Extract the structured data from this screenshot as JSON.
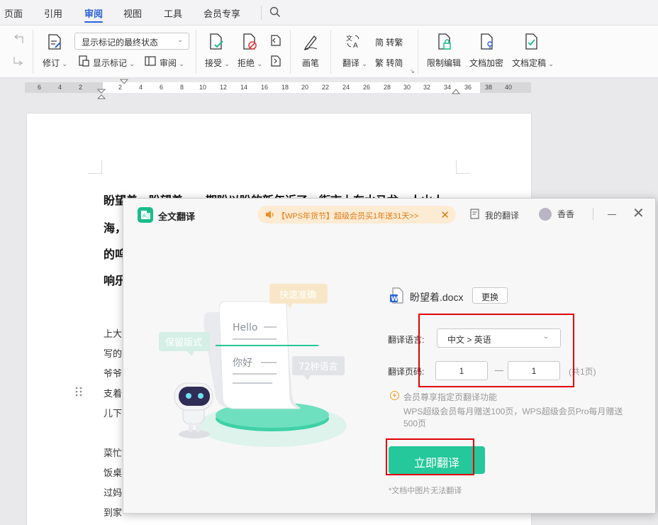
{
  "menubar": {
    "tabs": [
      {
        "label": "页面"
      },
      {
        "label": "引用"
      },
      {
        "label": "审阅"
      },
      {
        "label": "视图"
      },
      {
        "label": "工具"
      },
      {
        "label": "会员专享"
      }
    ],
    "active_tab": "审阅"
  },
  "ribbon": {
    "revise_label": "修订",
    "markup_state": "显示标记的最终状态",
    "show_markup_label": "显示标记",
    "review_label": "审阅",
    "accept_label": "接受",
    "reject_label": "拒绝",
    "pen_label": "画笔",
    "translate_label": "翻译",
    "to_traditional_label": "简 转繁",
    "to_simplified_label": "繁 转简",
    "restrict_edit_label": "限制编辑",
    "encrypt_label": "文档加密",
    "finalize_label": "文档定稿"
  },
  "ruler": {
    "left_numbers": [
      "6",
      "4",
      "2"
    ],
    "right_numbers": [
      "2",
      "4",
      "6",
      "8",
      "10",
      "12",
      "14",
      "16",
      "18",
      "20",
      "22",
      "24",
      "26",
      "28",
      "30",
      "32",
      "34",
      "36",
      "38",
      "40"
    ]
  },
  "document": {
    "heading_lines": [
      "盼望着，盼望着……期盼以盼的新年近了，街市上车水马龙，人山人",
      "海，",
      "的呜",
      "响乐"
    ],
    "body_lines": [
      "上大",
      "写的",
      "爷爷",
      "支着",
      "儿下",
      "菜忙",
      "饭桌",
      "过妈",
      "到家"
    ]
  },
  "dialog": {
    "title": "全文翻译",
    "promo_text": "【WPS年货节】超级会员买1年送31天>>",
    "my_translations": "我的翻译",
    "username": "香香",
    "illustration": {
      "tag_fast": "快速准确",
      "tag_layout": "保留版式",
      "tag_languages": "72种语言",
      "word_hello": "Hello",
      "word_nihao": "你好"
    },
    "file_name": "盼望着.docx",
    "change_button": "更换",
    "language_label": "翻译语言:",
    "language_value": "中文 > 英语",
    "pages_label": "翻译页码:",
    "page_from": "1",
    "page_to": "1",
    "page_total": "(共1页)",
    "vip_title": "会员尊享指定页翻译功能",
    "vip_desc": "WPS超级会员每月赠送100页，WPS超级会员Pro每月赠送500页",
    "translate_button": "立即翻译",
    "footnote": "*文档中图片无法翻译"
  },
  "colors": {
    "accent_blue": "#2b62d9",
    "brand_green": "#24c89b",
    "promo_orange": "#e27a13",
    "highlight_red": "#e00000"
  }
}
